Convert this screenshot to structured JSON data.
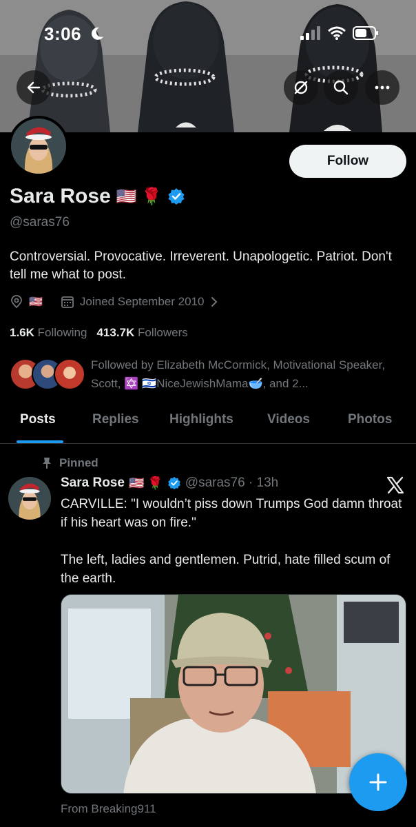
{
  "status": {
    "time": "3:06",
    "icons": [
      "moon-icon",
      "signal-icon",
      "wifi-icon",
      "battery-icon"
    ]
  },
  "header": {
    "back_icon": "arrow-left-icon",
    "icons": [
      "circle-slash-icon",
      "search-icon",
      "more-icon"
    ]
  },
  "profile": {
    "display_name": "Sara Rose",
    "name_emojis": "🇺🇸 🌹",
    "verified": true,
    "handle": "@saras76",
    "follow_label": "Follow",
    "bio": "Controversial. Provocative. Irreverent. Unapologetic. Patriot. Don't tell me what to post.",
    "location_flag": "🇺🇸",
    "joined": "Joined September 2010",
    "following_count": "1.6K",
    "following_label": "Following",
    "followers_count": "413.7K",
    "followers_label": "Followers",
    "followed_by": "Followed by Elizabeth McCormick, Motivational Speaker, Scott, ✡️ 🇮🇱NiceJewishMama🥣, and 2..."
  },
  "tabs": [
    {
      "label": "Posts",
      "active": true
    },
    {
      "label": "Replies",
      "active": false
    },
    {
      "label": "Highlights",
      "active": false
    },
    {
      "label": "Videos",
      "active": false
    },
    {
      "label": "Photos",
      "active": false
    }
  ],
  "tweet": {
    "pinned_label": "Pinned",
    "author_name": "Sara Rose",
    "author_emojis": "🇺🇸 🌹",
    "handle_time": "@saras76 · 13h",
    "text": "CARVILLE: \"I wouldn’t piss down Trumps God damn throat if his heart was on fire.\"\n\nThe left, ladies and gentlemen. Putrid, hate filled scum of the earth.",
    "source": "From Breaking911"
  },
  "colors": {
    "accent": "#1d9bf0",
    "muted": "#71767b",
    "text": "#e7e9ea",
    "background": "#000000"
  }
}
